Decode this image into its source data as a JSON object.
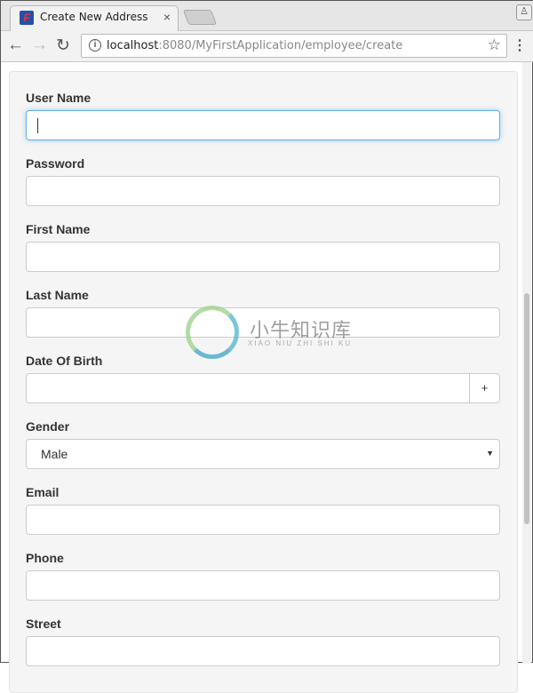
{
  "browser": {
    "tab_title": "Create New Address",
    "url_host": "localhost",
    "url_path": ":8080/MyFirstApplication/employee/create"
  },
  "form": {
    "fields": [
      {
        "label": "User Name",
        "value": ""
      },
      {
        "label": "Password",
        "value": ""
      },
      {
        "label": "First Name",
        "value": ""
      },
      {
        "label": "Last Name",
        "value": ""
      },
      {
        "label": "Date Of Birth",
        "value": "",
        "addon": "+"
      },
      {
        "label": "Gender",
        "value": "Male"
      },
      {
        "label": "Email",
        "value": ""
      },
      {
        "label": "Phone",
        "value": ""
      },
      {
        "label": "Street",
        "value": ""
      }
    ]
  },
  "watermark": {
    "text": "小牛知识库",
    "pinyin": "XIAO NIU ZHI SHI KU"
  }
}
